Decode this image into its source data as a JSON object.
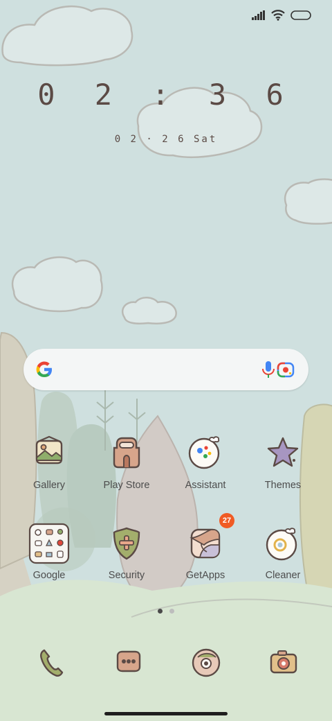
{
  "clock": {
    "time": "0 2 : 3 6",
    "date": "0 2 · 2 6  Sat"
  },
  "status_icons": [
    "signal-icon",
    "wifi-icon",
    "battery-icon"
  ],
  "search": {
    "google_icon": "google-g-icon",
    "mic_icon": "mic-icon",
    "lens_icon": "lens-icon"
  },
  "apps_row1": [
    {
      "label": "Gallery",
      "icon": "gallery-icon"
    },
    {
      "label": "Play Store",
      "icon": "play-store-icon"
    },
    {
      "label": "Assistant",
      "icon": "assistant-icon"
    },
    {
      "label": "Themes",
      "icon": "themes-icon"
    }
  ],
  "apps_row2": [
    {
      "label": "Google",
      "icon": "google-folder-icon"
    },
    {
      "label": "Security",
      "icon": "security-icon"
    },
    {
      "label": "GetApps",
      "icon": "getapps-icon",
      "badge": "27"
    },
    {
      "label": "Cleaner",
      "icon": "cleaner-icon"
    }
  ],
  "page_indicator": {
    "pages": 2,
    "active": 1
  },
  "dock": [
    "phone-icon",
    "messages-icon",
    "browser-icon",
    "camera-icon"
  ],
  "colors": {
    "badge": "#f05b24",
    "sky": "#cfe0df",
    "text": "#4d4d4d"
  }
}
